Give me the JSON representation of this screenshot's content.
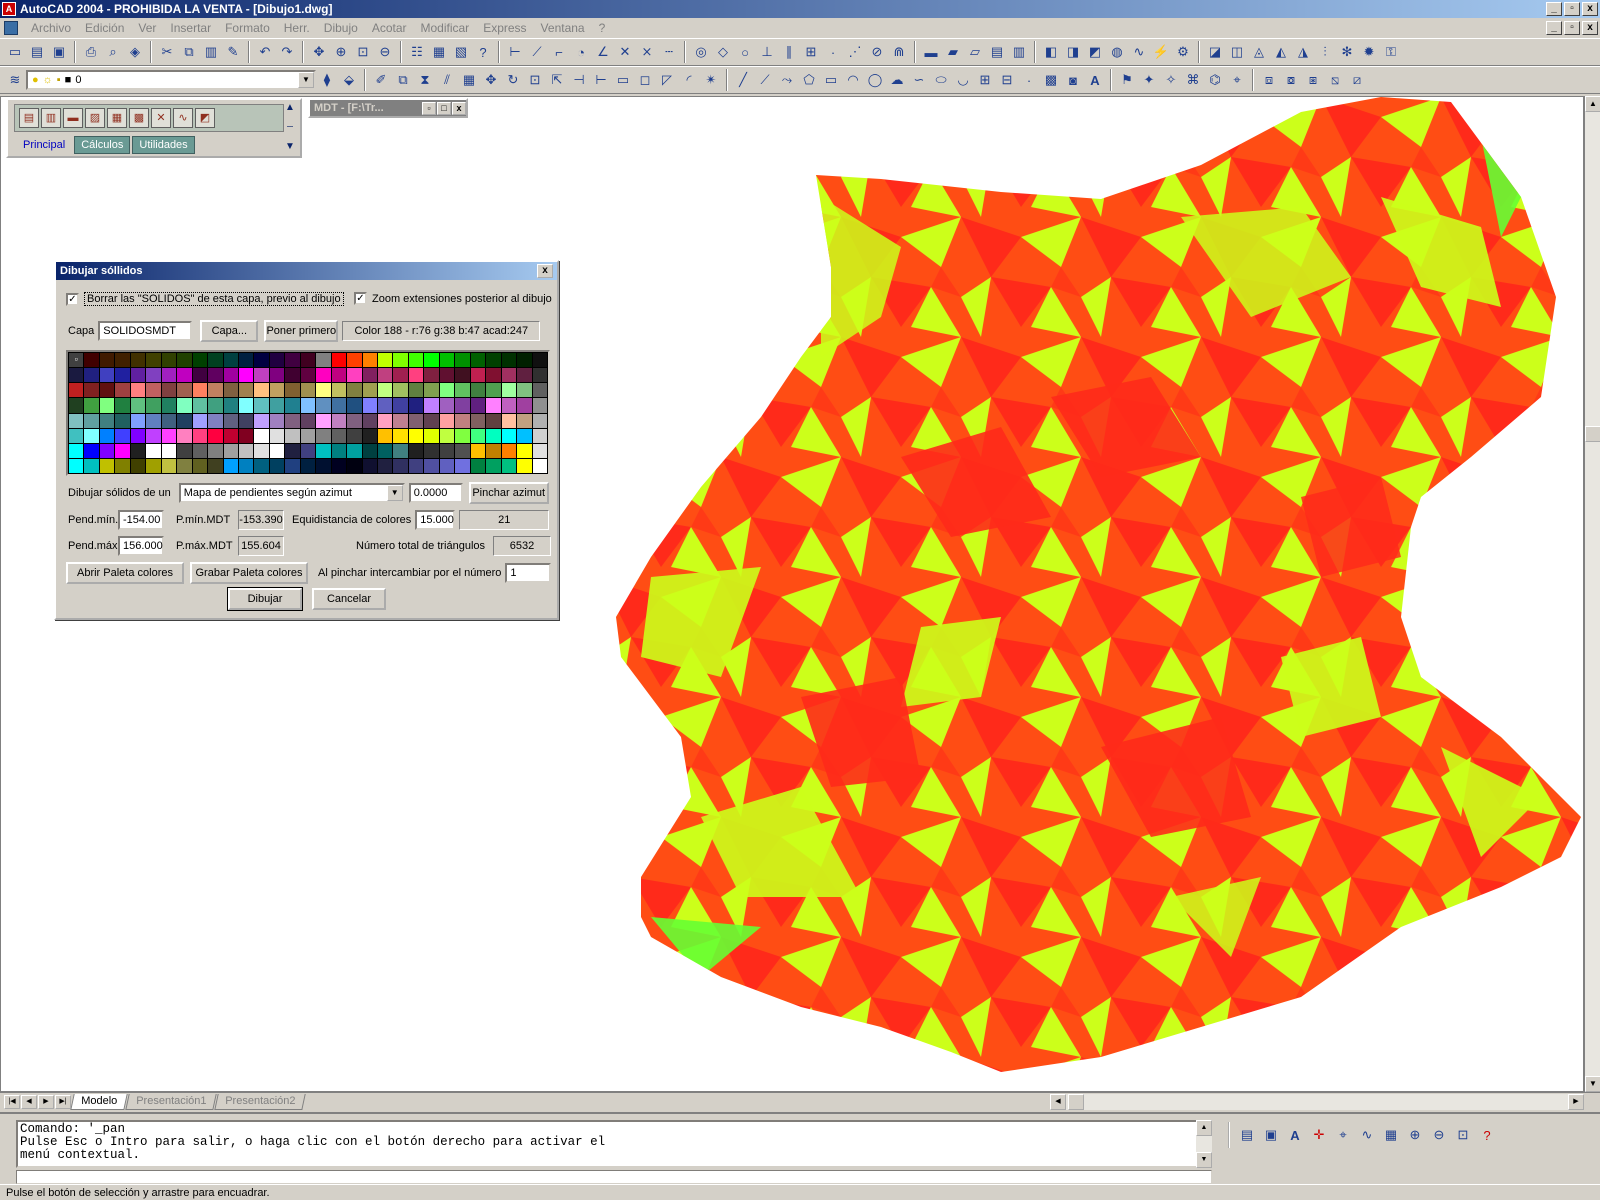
{
  "window": {
    "title": "AutoCAD 2004 - PROHIBIDA LA VENTA - [Dibujo1.dwg]",
    "controls": [
      "_",
      "▫",
      "x"
    ]
  },
  "menu": {
    "items": [
      "Archivo",
      "Edición",
      "Ver",
      "Insertar",
      "Formato",
      "Herr.",
      "Dibujo",
      "Acotar",
      "Modificar",
      "Express",
      "Ventana",
      "?"
    ]
  },
  "layer_toolbar": {
    "current_layer": "0"
  },
  "mdt_palette": {
    "tabs": [
      "Principal",
      "Cálculos",
      "Utilidades"
    ],
    "active_tab": "Principal"
  },
  "mdt_window": {
    "title": "MDT - [F:\\Tr..."
  },
  "dialog": {
    "title": "Dibujar sóllidos",
    "checkbox_borrar": "Borrar las \"SOLIDOS\" de esta capa, previo al dibujo",
    "checkbox_zoom": "Zoom extensiones posterior al dibujo",
    "capa_label": "Capa",
    "capa_value": "SOLIDOSMDT",
    "capa_button": "Capa...",
    "poner_primero_button": "Poner primero",
    "color_info": "Color 188 - r:76 g:38 b:47 acad:247",
    "dibujar_label": "Dibujar sólidos de un",
    "dibujar_mode": "Mapa de pendientes según azimut",
    "azimut_value": "0.0000",
    "pinchar_azimut_button": "Pinchar azimut",
    "pend_min_label": "Pend.mín.",
    "pend_min_value": "-154.00",
    "pmin_mdt_label": "P.mín.MDT",
    "pmin_mdt_value": "-153.390",
    "equidistancia_label": "Equidistancia de colores",
    "equidistancia_value": "15.000",
    "equidistancia_count": "21",
    "pend_max_label": "Pend.máx",
    "pend_max_value": "156.000",
    "pmax_mdt_label": "P.máx.MDT",
    "pmax_mdt_value": "155.604",
    "total_triangulos_label": "Número total de triángulos",
    "total_triangulos_value": "6532",
    "abrir_paleta_button": "Abrir Paleta colores",
    "grabar_paleta_button": "Grabar Paleta colores",
    "intercambiar_label": "Al pinchar intercambiar por el número",
    "intercambiar_value": "1",
    "dibujar_button": "Dibujar",
    "cancelar_button": "Cancelar",
    "swatch_marker": "▫"
  },
  "layout_tabs": [
    "Modelo",
    "Presentación1",
    "Presentación2"
  ],
  "command": {
    "line1": "Comando: '_pan",
    "line2": "Pulse Esc o Intro para salir, o haga clic con el botón derecho para activar el",
    "line3": "menú contextual."
  },
  "status": {
    "text": "Pulse el botón de selección y arrastre para encuadrar."
  },
  "colors": {
    "terrain_red": "#ff2a1a",
    "terrain_orange": "#ff4d14",
    "terrain_yellow_green": "#ccff1a",
    "terrain_green": "#66ff33",
    "title_bar": "#0a246a"
  }
}
